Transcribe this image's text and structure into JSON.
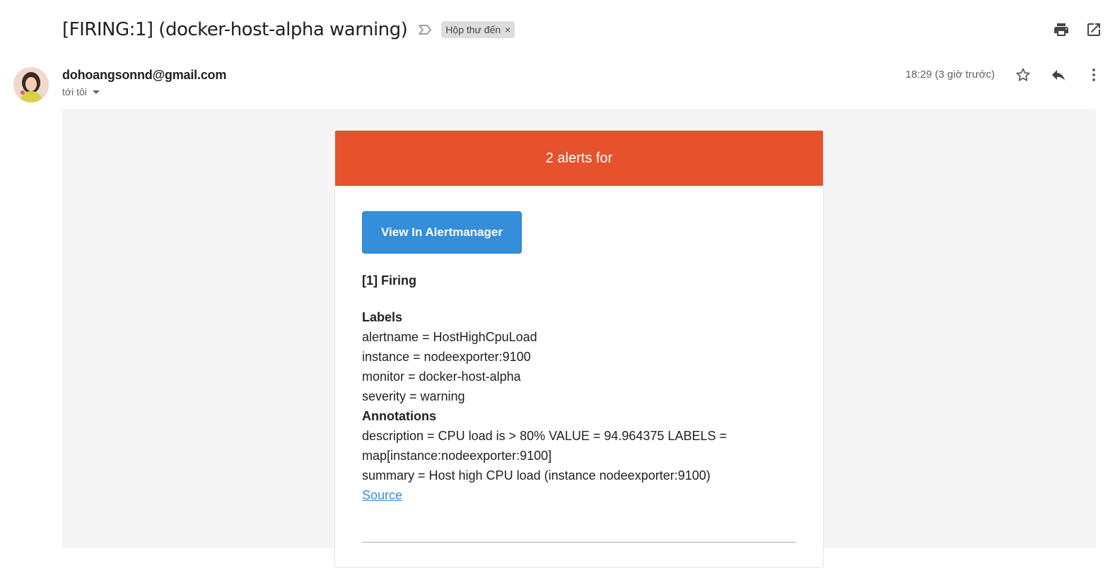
{
  "email": {
    "subject": "[FIRING:1] (docker-host-alpha warning)",
    "label_chip": "Hộp thư đến",
    "label_chip_close": "×",
    "sender": "dohoangsonnd@gmail.com",
    "to_line": "tới tôi",
    "timestamp": "18:29 (3 giờ trước)"
  },
  "icons": {
    "importance": "importance-marker-icon",
    "print": "print-icon",
    "open_new_window": "open-in-new-window-icon",
    "star": "star-icon",
    "reply": "reply-icon",
    "more": "more-vert-icon"
  },
  "alert": {
    "header": "2 alerts for",
    "header_color": "#e6522c",
    "button_label": "View In Alertmanager",
    "button_color": "#348eda",
    "firing_title": "[1] Firing",
    "labels_title": "Labels",
    "labels": [
      "alertname = HostHighCpuLoad",
      "instance = nodeexporter:9100",
      "monitor = docker-host-alpha",
      "severity = warning"
    ],
    "annotations_title": "Annotations",
    "annotations": [
      "description = CPU load is > 80% VALUE = 94.964375 LABELS =",
      "map[instance:nodeexporter:9100]",
      "summary = Host high CPU load (instance nodeexporter:9100)"
    ],
    "source_link": "Source"
  }
}
